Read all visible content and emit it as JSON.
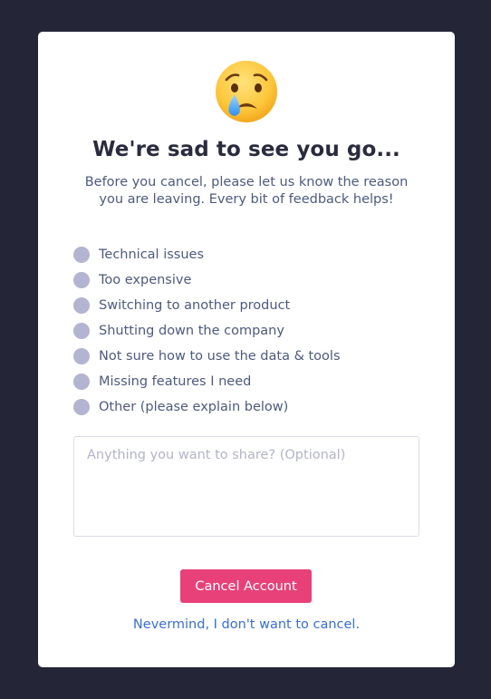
{
  "dialog": {
    "emoji": "crying-face-icon",
    "title": "We're sad to see you go...",
    "subtitle": "Before you cancel, please let us know the reason you are leaving. Every bit of feedback helps!",
    "reasons": [
      {
        "label": "Technical issues",
        "selected": false
      },
      {
        "label": "Too expensive",
        "selected": false
      },
      {
        "label": "Switching to another product",
        "selected": false
      },
      {
        "label": "Shutting down the company",
        "selected": false
      },
      {
        "label": "Not sure how to use the data & tools",
        "selected": false
      },
      {
        "label": "Missing features I need",
        "selected": false
      },
      {
        "label": "Other (please explain below)",
        "selected": false
      }
    ],
    "feedback": {
      "value": "",
      "placeholder": "Anything you want to share? (Optional)"
    },
    "cancel_button_label": "Cancel Account",
    "nevermind_link": "Nevermind, I don't want to cancel."
  },
  "colors": {
    "background": "#252538",
    "card": "#ffffff",
    "title": "#2b2b3f",
    "text": "#4d5a80",
    "radio": "#b3b4d2",
    "accent": "#e8417a",
    "link": "#3a6ed8"
  }
}
